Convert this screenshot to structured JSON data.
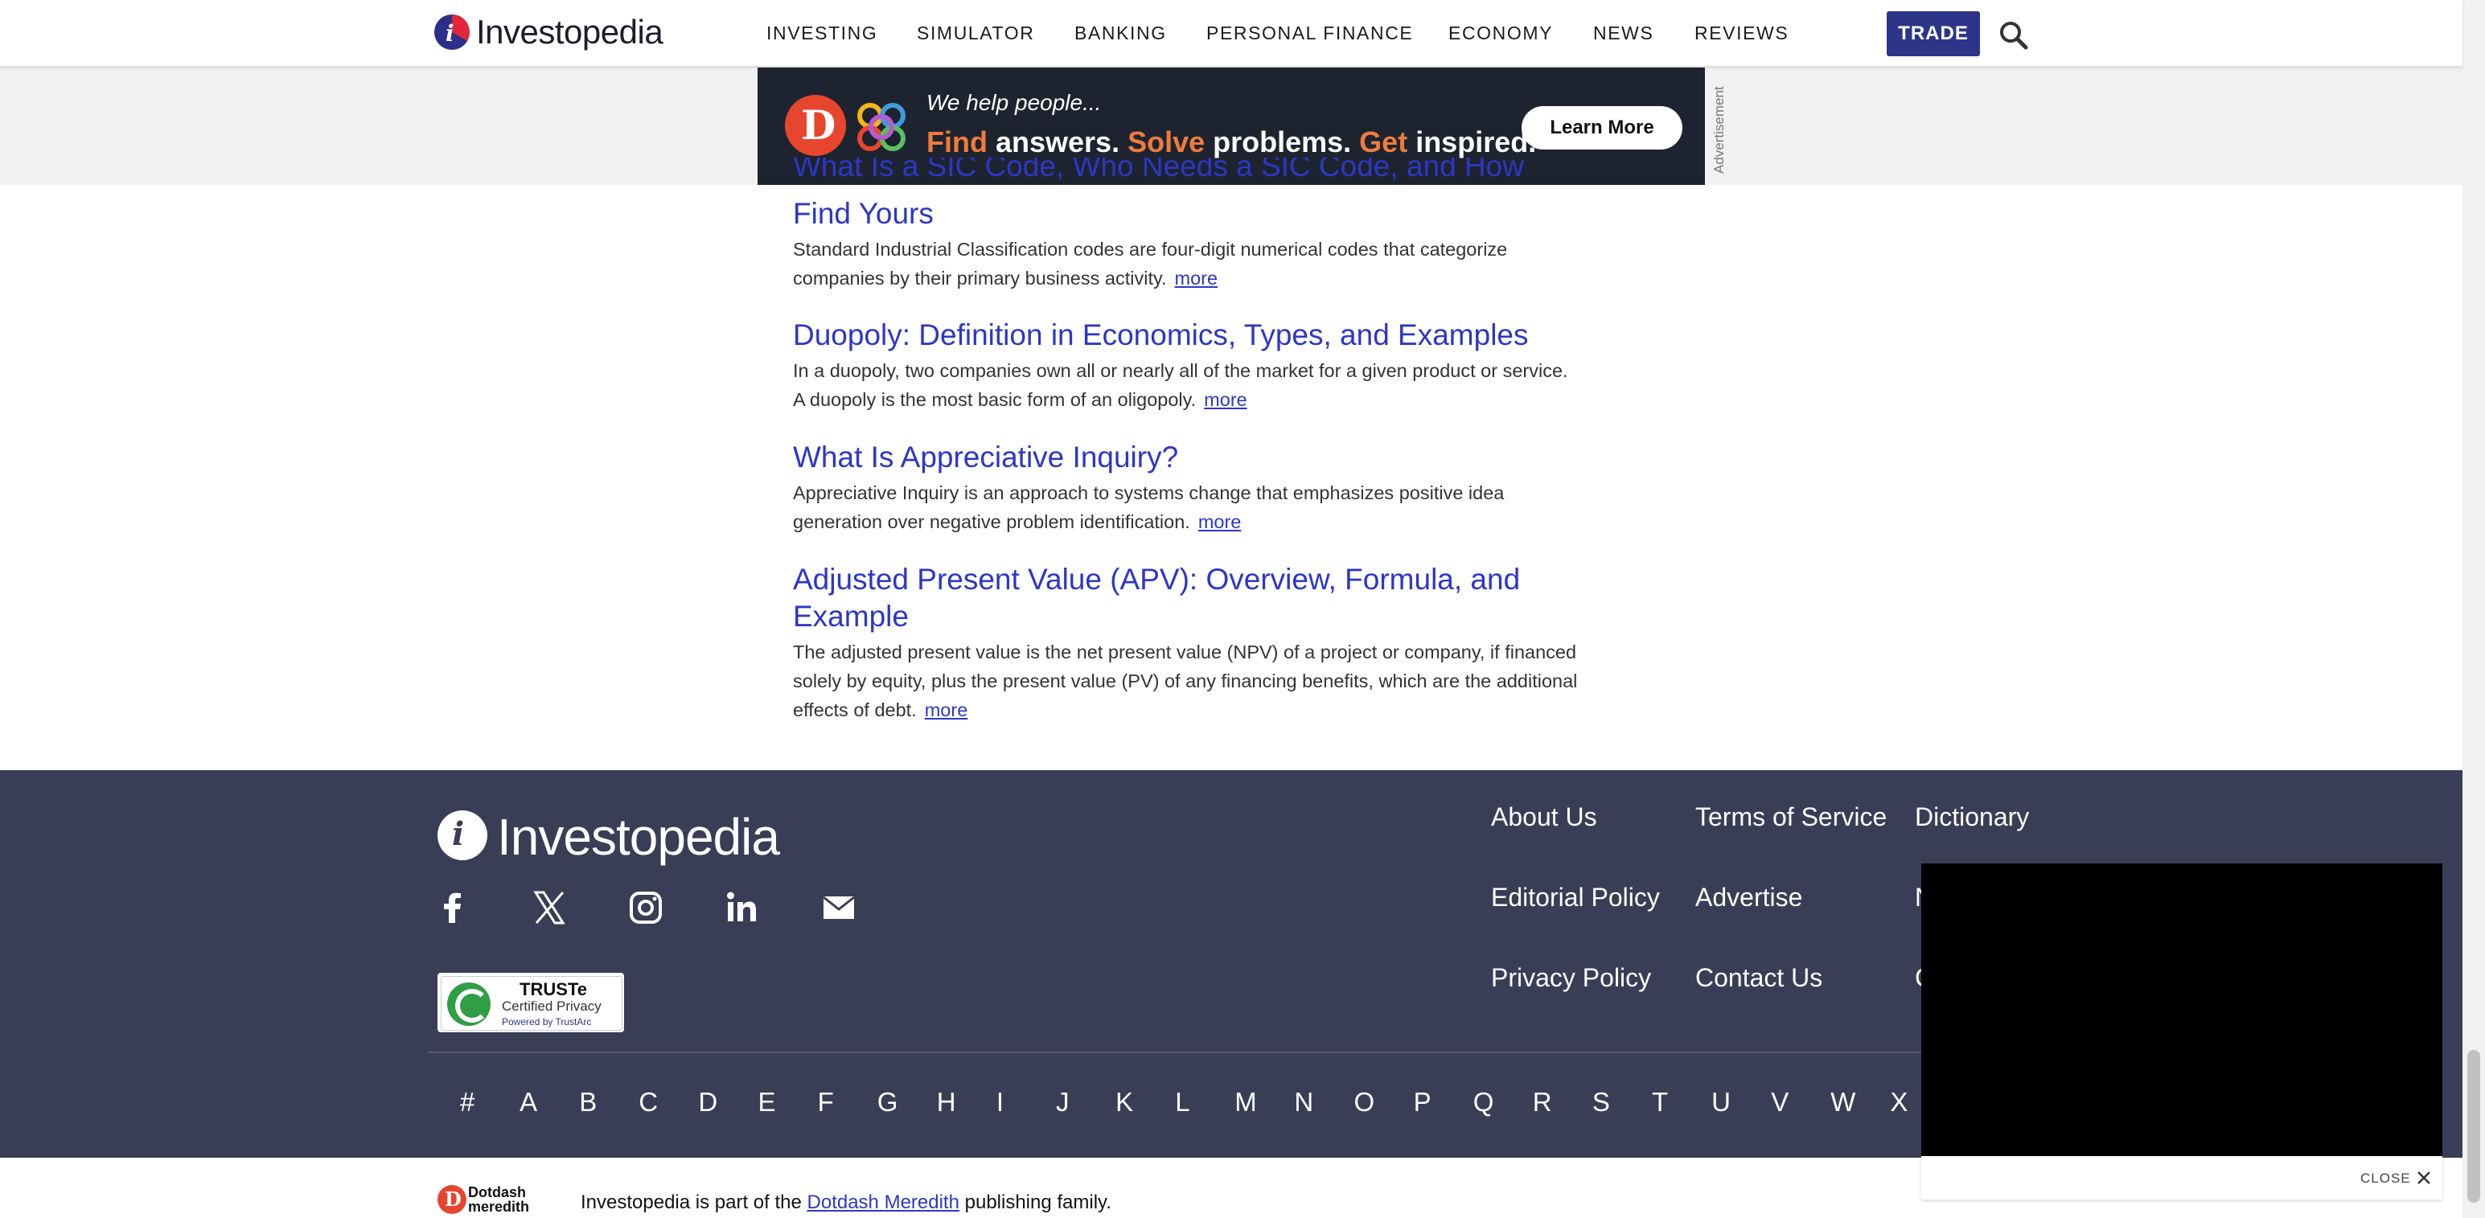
{
  "header": {
    "logo_text": "Investopedia",
    "nav": [
      "INVESTING",
      "SIMULATOR",
      "BANKING",
      "PERSONAL FINANCE",
      "ECONOMY",
      "NEWS",
      "REVIEWS"
    ],
    "trade_label": "TRADE",
    "search_icon": "search-icon"
  },
  "ad": {
    "line1": "We help people...",
    "line2_parts": [
      "Find",
      " answers. ",
      "Solve",
      " problems. ",
      "Get",
      " inspired."
    ],
    "cta": "Learn More",
    "label": "Advertisement"
  },
  "articles": [
    {
      "title": "Find Yours",
      "title_partial": "What Is a SIC Code, Who Needs a SIC Code, and How To",
      "desc": "Standard Industrial Classification codes are four-digit numerical codes that categorize companies by their primary business activity.",
      "more": "more"
    },
    {
      "title": "Duopoly: Definition in Economics, Types, and Examples",
      "desc": "In a duopoly, two companies own all or nearly all of the market for a given product or service. A duopoly is the most basic form of an oligopoly.",
      "more": "more"
    },
    {
      "title": "What Is Appreciative Inquiry?",
      "desc": "Appreciative Inquiry is an approach to systems change that emphasizes positive idea generation over negative problem identification.",
      "more": "more"
    },
    {
      "title": "Adjusted Present Value (APV): Overview, Formula, and Example",
      "desc": "The adjusted present value is the net present value (NPV) of a project or company, if financed solely by equity, plus the present value (PV) of any financing benefits, which are the additional effects of debt.",
      "more": "more"
    }
  ],
  "footer": {
    "logo_text": "Investopedia",
    "social": [
      "facebook-icon",
      "x-icon",
      "instagram-icon",
      "linkedin-icon",
      "email-icon"
    ],
    "truste": {
      "title": "TRUSTe",
      "sub": "Certified Privacy",
      "powered": "Powered by TrustArc"
    },
    "links_col1": [
      "About Us",
      "Editorial Policy",
      "Privacy Policy"
    ],
    "links_col2": [
      "Terms of Service",
      "Advertise",
      "Contact Us"
    ],
    "links_col3": [
      "Dictionary",
      "N",
      "C"
    ],
    "az": [
      "#",
      "A",
      "B",
      "C",
      "D",
      "E",
      "F",
      "G",
      "H",
      "I",
      "J",
      "K",
      "L",
      "M",
      "N",
      "O",
      "P",
      "Q",
      "R",
      "S",
      "T",
      "U",
      "V",
      "W",
      "X"
    ]
  },
  "bottom": {
    "dd_logo_line1": "Dotdash",
    "dd_logo_line2": "meredith",
    "text_before": "Investopedia is part of the ",
    "link": "Dotdash Meredith",
    "text_after": " publishing family."
  },
  "video": {
    "close_label": "CLOSE"
  },
  "colors": {
    "link": "#2c37c7",
    "footer_bg": "#3a3d56",
    "trade_bg": "#2d3589",
    "ad_orange": "#f07b3a"
  }
}
